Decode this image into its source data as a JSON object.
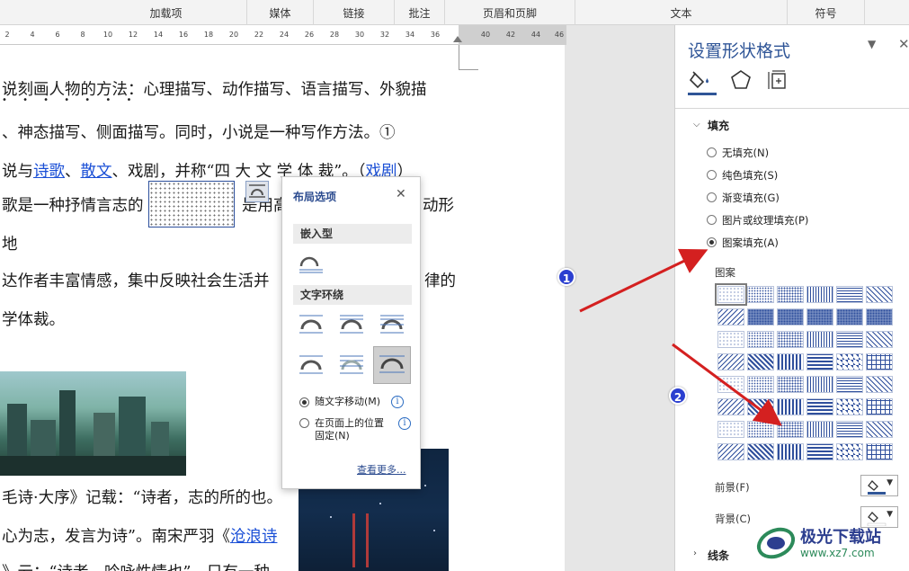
{
  "ribbon": {
    "groups": [
      "加载项",
      "媒体",
      "链接",
      "批注",
      "页眉和页脚",
      "文本",
      "符号"
    ]
  },
  "ruler": {
    "ticks": [
      "2",
      "4",
      "6",
      "8",
      "10",
      "12",
      "14",
      "16",
      "18",
      "20",
      "22",
      "24",
      "26",
      "28",
      "30",
      "32",
      "34",
      "36",
      "40",
      "42",
      "44",
      "46"
    ]
  },
  "document": {
    "lines": [
      {
        "text": "说刻画人物的方法：心理描写、动作描写、语言描写、外貌描"
      },
      {
        "text": "、神态描写、侧面描写。同时，小说是一种写作方法。①"
      },
      {
        "before": "说与",
        "link1": "诗歌",
        "sep": "、",
        "link2": "散文",
        "after": "、戏剧，并称“四 大 文 学 体 裁”。（",
        "link3": "戏剧",
        "end": "）"
      },
      {
        "before": "歌是一种抒情言志的",
        "after1": "是用高",
        "after2": "动形"
      },
      {
        "text": "地"
      },
      {
        "before": "达作者丰富情感，集中反映社会生活并",
        "after": "律的"
      },
      {
        "text": "学体裁。"
      },
      {
        "text": "毛诗·大序》记载：“诗者，志的所的也。"
      },
      {
        "before": "心为志，发言为诗”。南宋严羽《",
        "link": "沧浪诗"
      },
      {
        "text": "》云：“诗者，吟咏性情也”。只有一种"
      }
    ],
    "emphasis_dots": "• • • • • • •"
  },
  "layout_popup": {
    "title": "布局选项",
    "close": "✕",
    "section_inline": "嵌入型",
    "section_wrap": "文字环绕",
    "option_move": "随文字移动(M)",
    "option_fixed": "在页面上的位置\n固定(N)",
    "see_more": "查看更多..."
  },
  "format_pane": {
    "title": "设置形状格式",
    "fill_header": "填充",
    "fill_options": [
      {
        "label": "无填充(N)",
        "selected": false
      },
      {
        "label": "纯色填充(S)",
        "selected": false
      },
      {
        "label": "渐变填充(G)",
        "selected": false
      },
      {
        "label": "图片或纹理填充(P)",
        "selected": false
      },
      {
        "label": "图案填充(A)",
        "selected": true
      }
    ],
    "pattern_label": "图案",
    "foreground_label": "前景(F)",
    "background_label": "背景(C)",
    "line_header": "线条",
    "accent_color": "#2f5597",
    "pattern_color": "#2f4f9c"
  },
  "annotations": {
    "badge1": "1",
    "badge2": "2",
    "arrow_color": "#d42020"
  },
  "watermark": {
    "title": "极光下载站",
    "url": "www.xz7.com"
  }
}
